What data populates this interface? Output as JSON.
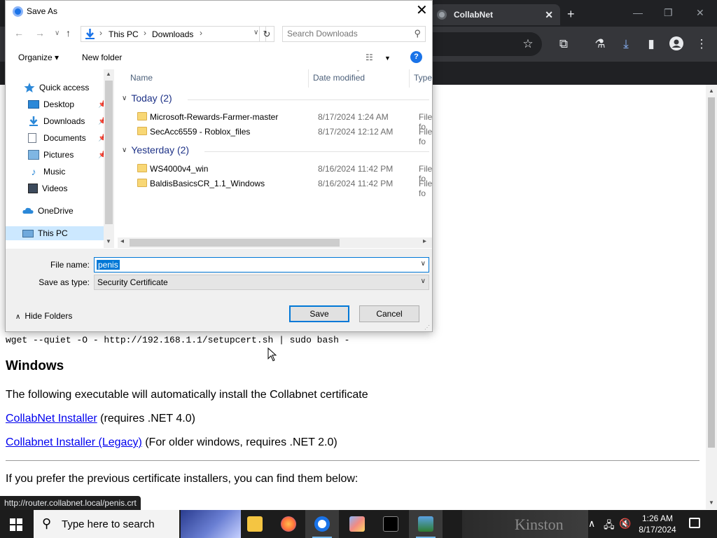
{
  "browser": {
    "tab_title": "CollabNet",
    "tab_close": "✕",
    "new_tab": "+",
    "window_controls": {
      "minimize": "—",
      "maximize": "❐",
      "close": "✕"
    },
    "toolbar_icons": [
      "star-icon",
      "extensions-icon",
      "labs-icon",
      "download-icon",
      "sidepanel-icon",
      "profile-icon",
      "menu-icon"
    ],
    "status_url": "http://router.collabnet.local/penis.crt"
  },
  "page": {
    "command": "wget --quiet -O - http://192.168.1.1/setupcert.sh | sudo bash -",
    "heading": "Windows",
    "paragraph1": "The following executable will automatically install the Collabnet certificate",
    "link1": "CollabNet Installer",
    "link1_suffix": " (requires .NET 4.0)",
    "link2": "Collabnet Installer (Legacy)",
    "link2_suffix": " (For older windows, requires .NET 2.0)",
    "paragraph2": "If you prefer the previous certificate installers, you can find them below:"
  },
  "dialog": {
    "title": "Save As",
    "close": "✕",
    "address": {
      "crumbs": [
        "This PC",
        "Downloads"
      ]
    },
    "search": {
      "placeholder": "Search Downloads"
    },
    "organize": "Organize ▾",
    "new_folder": "New folder",
    "view_icon": "☷",
    "help": "?",
    "nav": {
      "quick_access": "Quick access",
      "items": [
        {
          "label": "Desktop",
          "pinned": true
        },
        {
          "label": "Downloads",
          "pinned": true
        },
        {
          "label": "Documents",
          "pinned": true
        },
        {
          "label": "Pictures",
          "pinned": true
        },
        {
          "label": "Music",
          "pinned": false
        },
        {
          "label": "Videos",
          "pinned": false
        }
      ],
      "onedrive": "OneDrive",
      "this_pc": "This PC"
    },
    "columns": {
      "name": "Name",
      "date": "Date modified",
      "type": "Type"
    },
    "groups": [
      {
        "label": "Today (2)",
        "files": [
          {
            "name": "Microsoft-Rewards-Farmer-master",
            "date": "8/17/2024 1:24 AM",
            "type": "File fo"
          },
          {
            "name": "SecAcc6559 - Roblox_files",
            "date": "8/17/2024 12:12 AM",
            "type": "File fo"
          }
        ]
      },
      {
        "label": "Yesterday (2)",
        "files": [
          {
            "name": "WS4000v4_win",
            "date": "8/16/2024 11:42 PM",
            "type": "File fo"
          },
          {
            "name": "BaldisBasicsCR_1.1_Windows",
            "date": "8/16/2024 11:42 PM",
            "type": "File fo"
          }
        ]
      }
    ],
    "file_name_label": "File name:",
    "file_name_value": "penis",
    "save_type_label": "Save as type:",
    "save_type_value": "Security Certificate",
    "hide_folders": "Hide Folders",
    "save_button": "Save",
    "cancel_button": "Cancel"
  },
  "taskbar": {
    "search_placeholder": "Type here to search",
    "background_text": "Kinston",
    "time": "1:26 AM",
    "date": "8/17/2024"
  }
}
